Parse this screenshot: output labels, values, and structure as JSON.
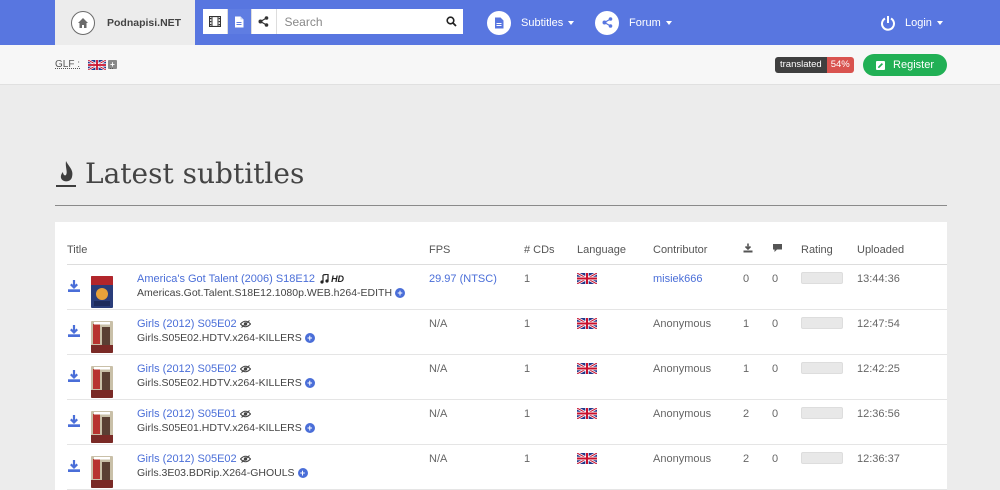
{
  "brand": {
    "name": "Podnapisi.NET"
  },
  "search": {
    "placeholder": "Search"
  },
  "nav": {
    "subtitles_label": "Subtitles",
    "forum_label": "Forum",
    "login_label": "Login"
  },
  "subbar": {
    "glf_label": "GLF :",
    "translated_label": "translated",
    "translated_percent": "54%",
    "register_label": "Register"
  },
  "page": {
    "title": "Latest subtitles"
  },
  "colors": {
    "nav_bg": "#5876e0",
    "register": "#21b055",
    "link": "#4a6ed8",
    "badge_red": "#d9534f"
  },
  "table": {
    "headers": {
      "title": "Title",
      "fps": "FPS",
      "cds": "# CDs",
      "language": "Language",
      "contributor": "Contributor",
      "rating": "Rating",
      "uploaded": "Uploaded"
    },
    "rows": [
      {
        "title": "America's Got Talent (2006) S18E12",
        "release": "Americas.Got.Talent.S18E12.1080p.WEB.h264-EDITH",
        "fps": "29.97 (NTSC)",
        "cds": "1",
        "contributor": "misiek666",
        "downloads": "0",
        "comments": "0",
        "uploaded": "13:44:36",
        "hd_label": "HD",
        "fps_is_link": true,
        "contributor_is_link": true,
        "icon": "music-note-icon"
      },
      {
        "title": "Girls (2012) S05E02",
        "release": "Girls.S05E02.HDTV.x264-KILLERS",
        "fps": "N/A",
        "cds": "1",
        "contributor": "Anonymous",
        "downloads": "1",
        "comments": "0",
        "uploaded": "12:47:54",
        "icon": "eye-icon"
      },
      {
        "title": "Girls (2012) S05E02",
        "release": "Girls.S05E02.HDTV.x264-KILLERS",
        "fps": "N/A",
        "cds": "1",
        "contributor": "Anonymous",
        "downloads": "1",
        "comments": "0",
        "uploaded": "12:42:25",
        "icon": "eye-icon"
      },
      {
        "title": "Girls (2012) S05E01",
        "release": "Girls.S05E01.HDTV.x264-KILLERS",
        "fps": "N/A",
        "cds": "1",
        "contributor": "Anonymous",
        "downloads": "2",
        "comments": "0",
        "uploaded": "12:36:56",
        "icon": "eye-icon"
      },
      {
        "title": "Girls (2012) S05E02",
        "release": "Girls.3E03.BDRip.X264-GHOULS",
        "fps": "N/A",
        "cds": "1",
        "contributor": "Anonymous",
        "downloads": "2",
        "comments": "0",
        "uploaded": "12:36:37",
        "icon": "eye-icon"
      }
    ]
  }
}
